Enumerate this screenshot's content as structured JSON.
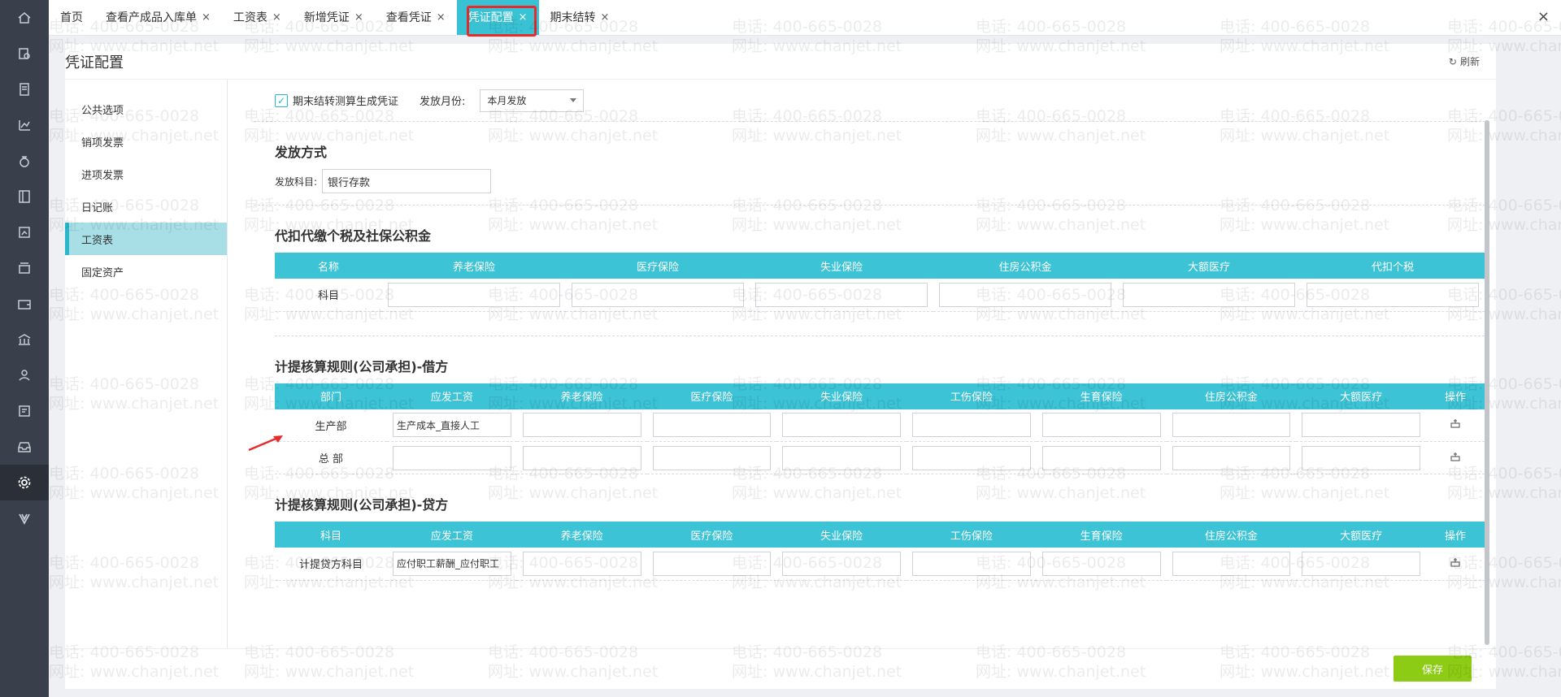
{
  "tabs": [
    {
      "label": "首页",
      "closable": false
    },
    {
      "label": "查看产成品入库单",
      "closable": true
    },
    {
      "label": "工资表",
      "closable": true
    },
    {
      "label": "新增凭证",
      "closable": true
    },
    {
      "label": "查看凭证",
      "closable": true
    },
    {
      "label": "凭证配置",
      "closable": true,
      "active": true
    },
    {
      "label": "期末结转",
      "closable": true
    }
  ],
  "close_glyph": "×",
  "page": {
    "title": "凭证配置",
    "refresh_label": "刷新"
  },
  "sidenav": [
    "公共选项",
    "销项发票",
    "进项发票",
    "日记账",
    "工资表",
    "固定资产"
  ],
  "options": {
    "checkbox_label": "期末结转测算生成凭证",
    "month_label": "发放月份:",
    "month_value": "本月发放"
  },
  "payment": {
    "title": "发放方式",
    "account_label": "发放科目:",
    "account_value": "银行存款"
  },
  "withholding": {
    "title": "代扣代缴个税及社保公积金",
    "headers": [
      "名称",
      "养老保险",
      "医疗保险",
      "失业保险",
      "住房公积金",
      "大额医疗",
      "代扣个税"
    ],
    "row_label": "科目"
  },
  "debit": {
    "title": "计提核算规则(公司承担)-借方",
    "headers": [
      "部门",
      "应发工资",
      "养老保险",
      "医疗保险",
      "失业保险",
      "工伤保险",
      "生育保险",
      "住房公积金",
      "大额医疗",
      "操作"
    ],
    "rows": [
      {
        "label": "生产部",
        "salary": "生产成本_直接人工"
      },
      {
        "label": "总 部",
        "salary": ""
      }
    ]
  },
  "credit": {
    "title": "计提核算规则(公司承担)-贷方",
    "headers": [
      "科目",
      "应发工资",
      "养老保险",
      "医疗保险",
      "失业保险",
      "工伤保险",
      "生育保险",
      "住房公积金",
      "大额医疗",
      "操作"
    ],
    "rows": [
      {
        "label": "计提贷方科目",
        "salary": "应付职工薪酬_应付职工"
      }
    ]
  },
  "footer": {
    "save_label": "保存"
  },
  "watermark": {
    "phone": "电话: 400-665-0028",
    "site": "网址: www.chanjet.net"
  },
  "colors": {
    "accent": "#3cc3d6",
    "save": "#8ccc14",
    "highlight": "#e52b2b"
  }
}
